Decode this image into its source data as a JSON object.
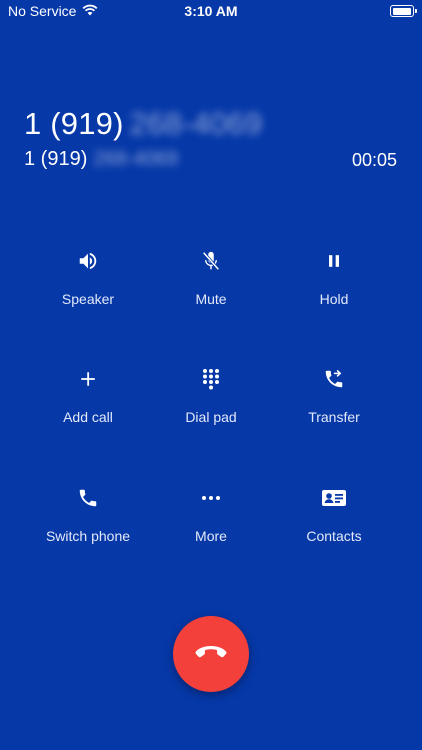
{
  "status_bar": {
    "carrier": "No Service",
    "time": "3:10 AM"
  },
  "caller": {
    "number_prefix": "1 (919)",
    "number_hidden": "268-4069",
    "sub_prefix": "1 (919)",
    "sub_hidden": "268-4069",
    "timer": "00:05"
  },
  "actions": [
    {
      "label": "Speaker",
      "icon": "speaker-icon"
    },
    {
      "label": "Mute",
      "icon": "mic-off-icon"
    },
    {
      "label": "Hold",
      "icon": "pause-icon"
    },
    {
      "label": "Add call",
      "icon": "plus-icon"
    },
    {
      "label": "Dial pad",
      "icon": "dialpad-icon"
    },
    {
      "label": "Transfer",
      "icon": "phone-forward-icon"
    },
    {
      "label": "Switch phone",
      "icon": "phone-icon"
    },
    {
      "label": "More",
      "icon": "more-icon"
    },
    {
      "label": "Contacts",
      "icon": "contact-card-icon"
    }
  ],
  "end_call": {
    "icon": "end-call-icon"
  },
  "colors": {
    "background": "#0638A8",
    "end_call": "#F4403A",
    "text": "#FFFFFF"
  }
}
